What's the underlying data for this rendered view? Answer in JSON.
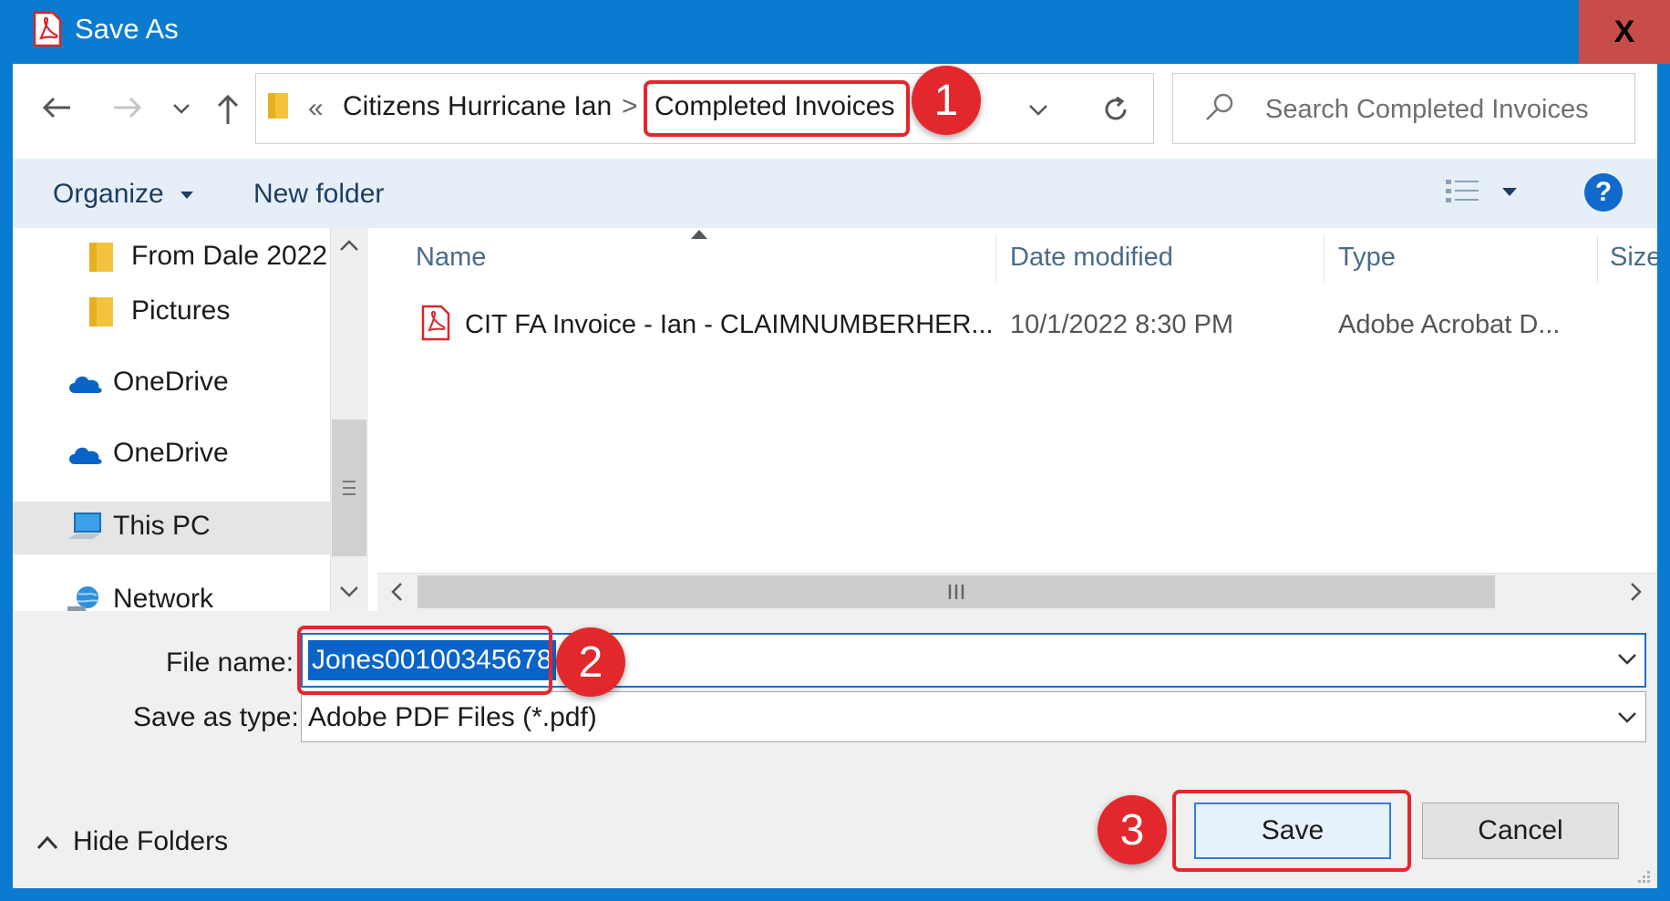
{
  "window": {
    "title": "Save As",
    "close_label": "X"
  },
  "address_bar": {
    "overflow_chevron": "«",
    "crumbs": [
      "Citizens Hurricane Ian",
      "Completed Invoices"
    ],
    "separator": ">"
  },
  "search": {
    "placeholder": "Search Completed Invoices"
  },
  "toolbar": {
    "organize_label": "Organize",
    "new_folder_label": "New folder",
    "help_label": "?"
  },
  "nav_pane": {
    "items": [
      {
        "label": "From Dale 2022",
        "icon": "folder-icon"
      },
      {
        "label": "Pictures",
        "icon": "folder-icon"
      },
      {
        "label": "OneDrive",
        "icon": "cloud-icon"
      },
      {
        "label": "OneDrive",
        "icon": "cloud-icon"
      },
      {
        "label": "This PC",
        "icon": "computer-icon",
        "selected": true
      },
      {
        "label": "Network",
        "icon": "network-icon"
      }
    ]
  },
  "file_list": {
    "columns": [
      "Name",
      "Date modified",
      "Type",
      "Size"
    ],
    "rows": [
      {
        "name": "CIT FA Invoice - Ian - CLAIMNUMBERHER...",
        "date_modified": "10/1/2022 8:30 PM",
        "type": "Adobe Acrobat D...",
        "icon": "pdf-icon"
      }
    ]
  },
  "form": {
    "file_name_label": "File name:",
    "file_name_value": "Jones00100345678",
    "save_as_type_label": "Save as type:",
    "save_as_type_value": "Adobe PDF Files (*.pdf)"
  },
  "footer": {
    "hide_folders_label": "Hide Folders",
    "save_label": "Save",
    "cancel_label": "Cancel"
  },
  "callouts": [
    "1",
    "2",
    "3"
  ],
  "colors": {
    "title_bar": "#0b7bd2",
    "close_button": "#c84c48",
    "highlight": "#e3282d",
    "selection": "#0a64c8"
  }
}
